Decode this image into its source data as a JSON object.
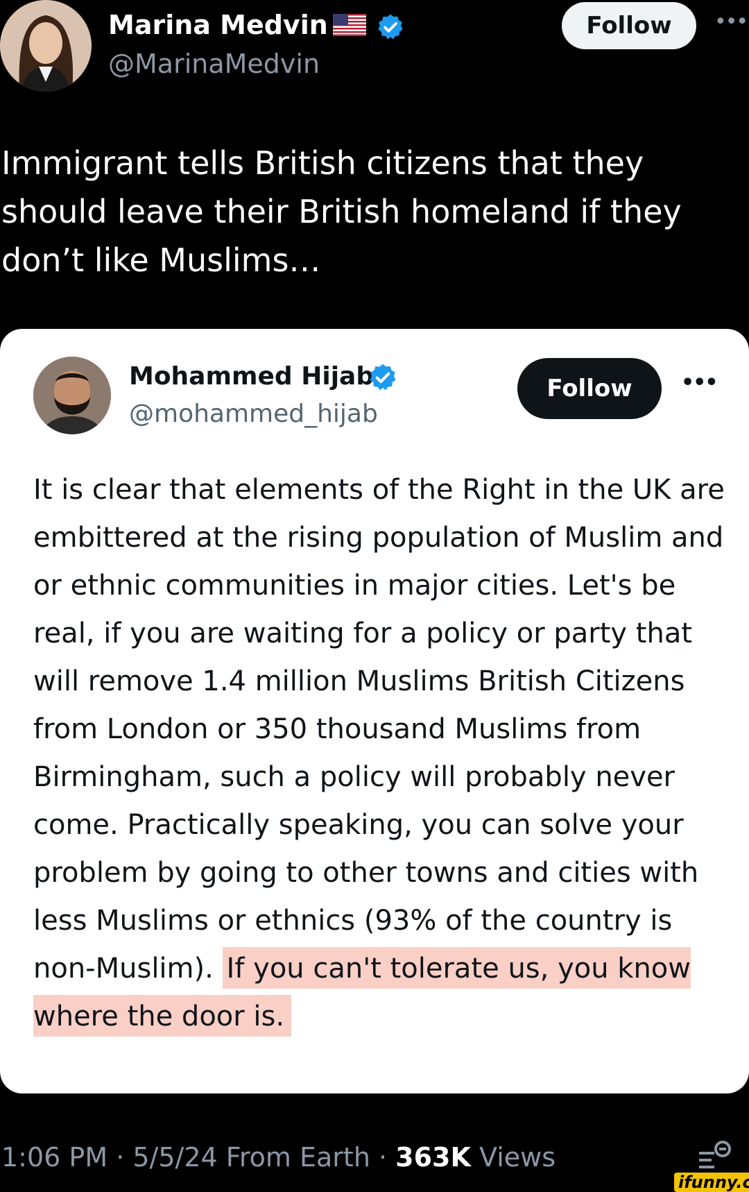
{
  "outer_tweet": {
    "author_name": "Marina Medvin",
    "author_handle": "@MarinaMedvin",
    "flag_icon": "us-flag-icon",
    "verified_icon": "verified-badge-icon",
    "follow_label": "Follow",
    "more_icon": "•••",
    "text": "Immigrant tells British citizens that they should leave their British homeland if they don’t like Muslims…"
  },
  "quoted_post": {
    "author_name": "Mohammed Hijab",
    "author_handle": "@mohammed_hijab",
    "verified_icon": "verified-badge-icon",
    "follow_label": "Follow",
    "more_icon": "•••",
    "body_main": "It is clear that elements of the Right in the UK are embittered at the rising population of Muslim and or ethnic communities in major cities. Let's be real, if you are waiting for a policy or party that will remove 1.4 million Muslims British Citizens from London or 350 thousand Muslims from Birmingham, such a policy will probably never come. Practically speaking, you can solve your problem by going to other towns and cities with less Muslims or ethnics (93% of the country is non-Muslim).",
    "body_highlight": "If you can't tolerate us, you know where the door is.",
    "highlight_color": "#f9cfc6"
  },
  "footer": {
    "time": "1:06 PM",
    "date": "5/5/24",
    "source": "From Earth",
    "views_count": "363K",
    "views_label": "Views",
    "sep": " · ",
    "watermark": "ifunny.co"
  },
  "colors": {
    "background": "#000000",
    "card": "#ffffff",
    "verified": "#1d9bf0",
    "secondary_text": "#8b98a5"
  }
}
